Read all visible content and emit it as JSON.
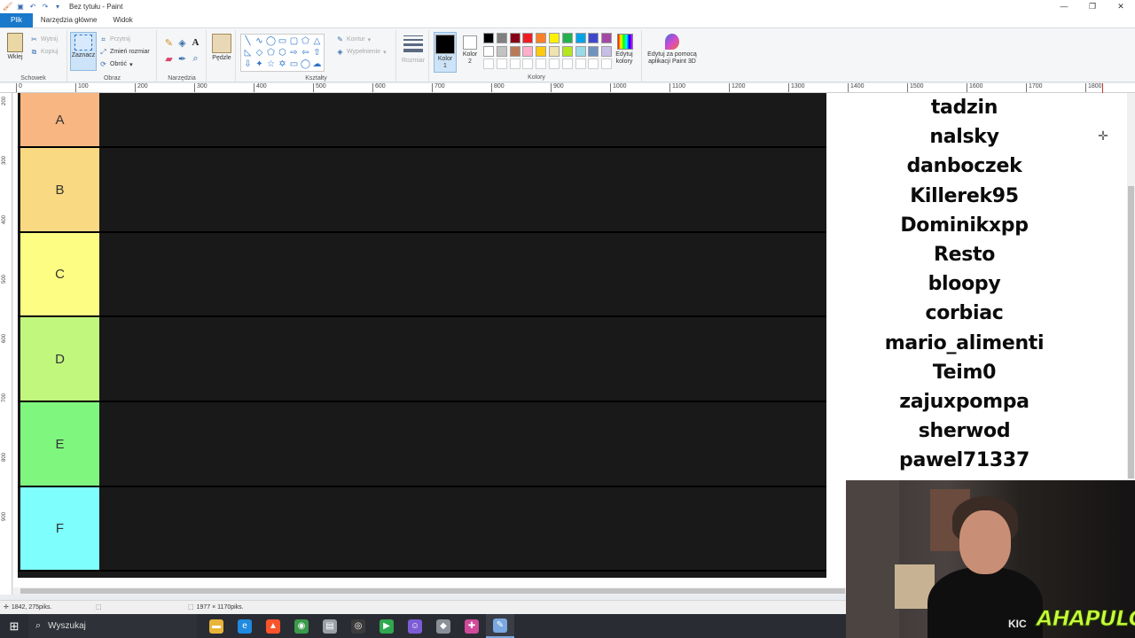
{
  "window": {
    "title": "Bez tytułu - Paint",
    "app_icon": "paint-icon",
    "controls": [
      "—",
      "❐",
      "✕"
    ]
  },
  "quick_access": [
    "save-icon",
    "undo-icon",
    "redo-icon"
  ],
  "tabs": [
    {
      "label": "Plik"
    },
    {
      "label": "Narzędzia główne"
    },
    {
      "label": "Widok"
    }
  ],
  "ribbon": {
    "clipboard": {
      "paste": "Wklej",
      "cut": "Wytnij",
      "copy": "Kopiuj",
      "label": "Schowek"
    },
    "image": {
      "select": "Zaznacz",
      "crop": "Przytnij",
      "resize": "Zmień rozmiar",
      "rotate": "Obróć",
      "label": "Obraz"
    },
    "tools": {
      "label": "Narzędzia"
    },
    "brushes": {
      "label": "Pędzle"
    },
    "shapes": {
      "outline": "Kontur",
      "fill": "Wypełnienie",
      "label": "Kształty"
    },
    "size": {
      "label": "Rozmiar"
    },
    "colors": {
      "color1": "Kolor 1",
      "color2": "Kolor 2",
      "edit": "Edytuj kolory",
      "label": "Kolory",
      "color1_value": "#000000",
      "color2_value": "#ffffff",
      "palette": [
        "#000000",
        "#7f7f7f",
        "#880015",
        "#ed1c24",
        "#ff7f27",
        "#fff200",
        "#22b14c",
        "#00a2e8",
        "#3f48cc",
        "#a349a4",
        "#ffffff",
        "#c3c3c3",
        "#b97a57",
        "#ffaec9",
        "#ffc90e",
        "#efe4b0",
        "#b5e61d",
        "#99d9ea",
        "#7092be",
        "#c8bfe7",
        "#ffffff",
        "#ffffff",
        "#ffffff",
        "#ffffff",
        "#ffffff",
        "#ffffff",
        "#ffffff",
        "#ffffff",
        "#ffffff",
        "#ffffff"
      ]
    },
    "paint3d": "Edytuj za pomocą aplikacji Paint 3D"
  },
  "ruler": {
    "top_ticks": [
      "0",
      "100",
      "200",
      "300",
      "400",
      "500",
      "600",
      "700",
      "800",
      "900",
      "1000",
      "1100",
      "1200",
      "1300",
      "1400",
      "1500",
      "1600",
      "1700",
      "1800"
    ],
    "left_ticks": [
      "200",
      "300",
      "400",
      "500",
      "600",
      "700",
      "800",
      "900"
    ]
  },
  "tiers": [
    {
      "label": "A",
      "color": "#f8b682"
    },
    {
      "label": "B",
      "color": "#f9d982"
    },
    {
      "label": "C",
      "color": "#fdfd83"
    },
    {
      "label": "D",
      "color": "#c2f77e"
    },
    {
      "label": "E",
      "color": "#7ff77f"
    },
    {
      "label": "F",
      "color": "#7ffefe"
    }
  ],
  "names": [
    "tadzin",
    "nalsky",
    "danboczek",
    "Killerek95",
    "Dominikxpp",
    "Resto",
    "bloopy",
    "corbiac",
    "mario_alimenti",
    "Teim0",
    "zajuxpompa",
    "sherwod",
    "pawel71337"
  ],
  "status": {
    "cursor_pos": "1842, 275piks.",
    "canvas_size": "1977 × 1170piks."
  },
  "taskbar": {
    "search_placeholder": "Wyszukaj",
    "apps": [
      {
        "name": "file-explorer-icon",
        "color": "#e8b43a",
        "glyph": "▬"
      },
      {
        "name": "edge-icon",
        "color": "#1f8ae0",
        "glyph": "e"
      },
      {
        "name": "brave-icon",
        "color": "#fb542b",
        "glyph": "▲"
      },
      {
        "name": "chrome-icon",
        "color": "#3a9a4a",
        "glyph": "◉"
      },
      {
        "name": "folder-app-icon",
        "color": "#9aa0a6",
        "glyph": "▤"
      },
      {
        "name": "obs-icon",
        "color": "#3b3b3b",
        "glyph": "◎"
      },
      {
        "name": "play-app-icon",
        "color": "#2fa84f",
        "glyph": "▶"
      },
      {
        "name": "discord-icon",
        "color": "#7c5cd6",
        "glyph": "☺"
      },
      {
        "name": "shield-app-icon",
        "color": "#8a8f98",
        "glyph": "◆"
      },
      {
        "name": "tool-app-icon",
        "color": "#d04a9a",
        "glyph": "✚"
      },
      {
        "name": "paint-taskbar-icon",
        "color": "#7aa8e0",
        "glyph": "✎"
      }
    ]
  },
  "webcam": {
    "logo_text": "AHAPULCO",
    "small_text": "KIC"
  }
}
